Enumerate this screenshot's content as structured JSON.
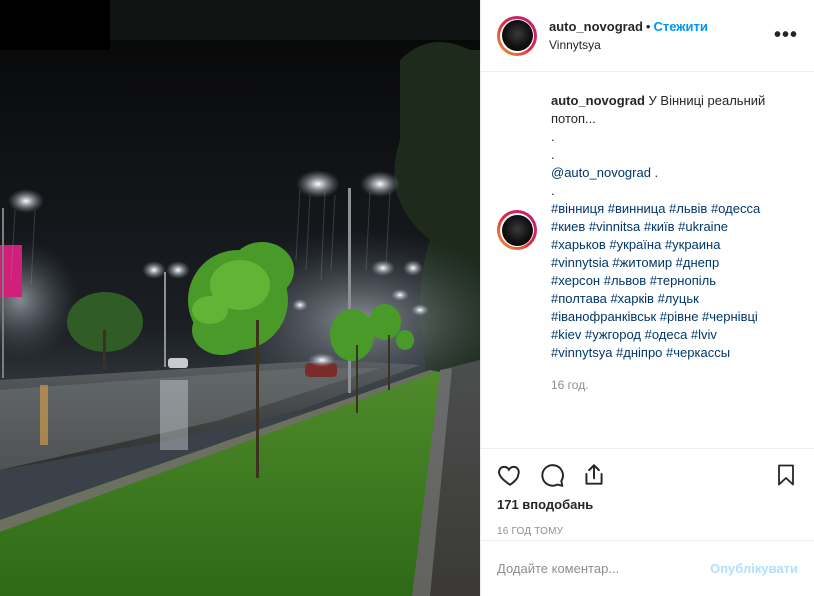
{
  "header": {
    "username": "auto_novograd",
    "separator": "•",
    "follow_label": "Стежити",
    "location": "Vinnytsya",
    "more_label": "•••"
  },
  "caption": {
    "username": "auto_novograd",
    "text": "У Вінниці реальний потоп...",
    "dot1": ".",
    "dot2": ".",
    "mention": "@auto_novograd",
    "mention_suffix": " .",
    "dot3": ".",
    "hashtag_lines": [
      "#вінниця #винница #львів #одесса",
      "#киев #vinnitsa #київ #ukraine",
      "#харьков #україна #украина",
      "#vinnytsia #житомир #днепр",
      "#херсон #львов #тернопіль",
      "#полтава #харків #луцьк",
      "#іванофранківськ #рівне #чернівці",
      "#kiev #ужгород #одеса #lviv",
      "#vinnytsya #дніпро #черкассы"
    ],
    "time": "16 год."
  },
  "actions": {
    "likes": "171 вподобань",
    "ago": "16 ГОД ТОМУ"
  },
  "comment_box": {
    "placeholder": "Додайте коментар...",
    "publish_label": "Опублікувати"
  },
  "colors": {
    "accent": "#0095f6",
    "hashtag": "#00376b",
    "muted": "#8e8e8e"
  }
}
